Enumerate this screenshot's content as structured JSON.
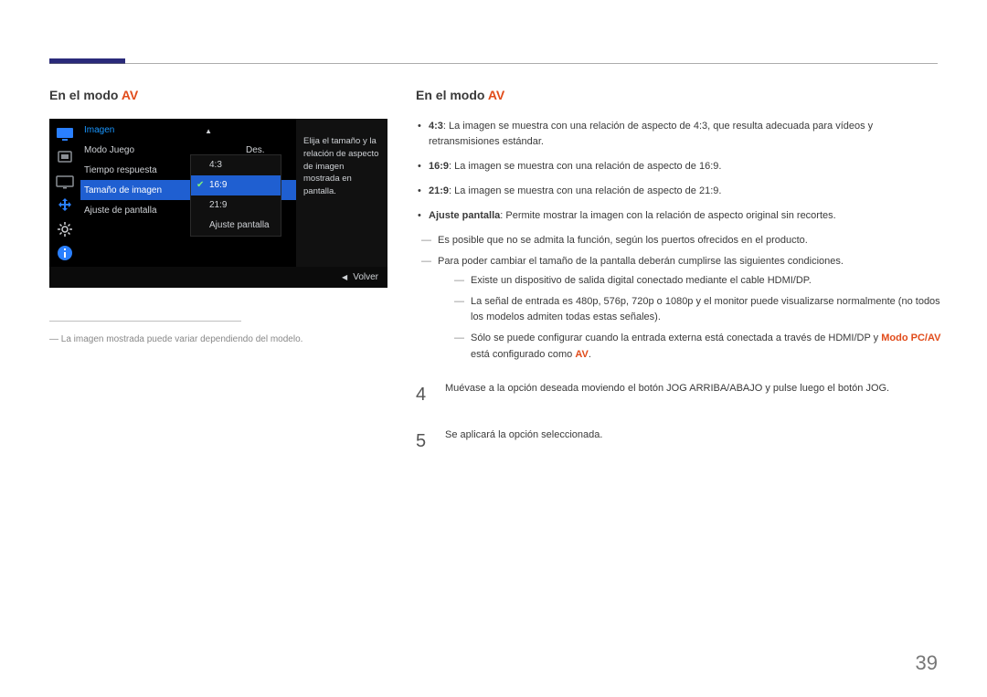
{
  "page_number": "39",
  "heading_base": "En el modo ",
  "heading_av": "AV",
  "osd": {
    "section": "Imagen",
    "rows": [
      {
        "label": "Modo Juego",
        "value": "Des."
      },
      {
        "label": "Tiempo respuesta",
        "value": ""
      },
      {
        "label": "Tamaño de imagen",
        "value": ""
      },
      {
        "label": "Ajuste de pantalla",
        "value": ""
      }
    ],
    "submenu": [
      "4:3",
      "16:9",
      "21:9",
      "Ajuste pantalla"
    ],
    "submenu_selected": "16:9",
    "help": "Elija el tamaño y la relación de aspecto de imagen mostrada en pantalla.",
    "back_label": "Volver"
  },
  "caption": "La imagen mostrada puede variar dependiendo del modelo.",
  "bullets": {
    "b1_label": "4:3",
    "b1_text": ": La imagen se muestra con una relación de aspecto de 4:3, que resulta adecuada para vídeos y retransmisiones estándar.",
    "b2_label": "16:9",
    "b2_text": ": La imagen se muestra con una relación de aspecto de 16:9.",
    "b3_label": "21:9",
    "b3_text": ": La imagen se muestra con una relación de aspecto de 21:9.",
    "b4_label": "Ajuste pantalla",
    "b4_text": ": Permite mostrar la imagen con la relación de aspecto original sin recortes."
  },
  "dashes": {
    "d1": "Es posible que no se admita la función, según los puertos ofrecidos en el producto.",
    "d2": "Para poder cambiar el tamaño de la pantalla deberán cumplirse las siguientes condiciones.",
    "d2a": "Existe un dispositivo de salida digital conectado mediante el cable HDMI/DP.",
    "d2b": "La señal de entrada es 480p, 576p, 720p o 1080p y el monitor puede visualizarse normalmente (no todos los modelos admiten todas estas señales).",
    "d2c_pre": "Sólo se puede configurar cuando la entrada externa está conectada a través de HDMI/DP y ",
    "d2c_hl1": "Modo PC/AV",
    "d2c_mid": " está configurado como ",
    "d2c_hl2": "AV",
    "d2c_post": "."
  },
  "steps": {
    "s4_num": "4",
    "s4_text": "Muévase a la opción deseada moviendo el botón JOG ARRIBA/ABAJO y pulse luego el botón JOG.",
    "s5_num": "5",
    "s5_text": "Se aplicará la opción seleccionada."
  }
}
